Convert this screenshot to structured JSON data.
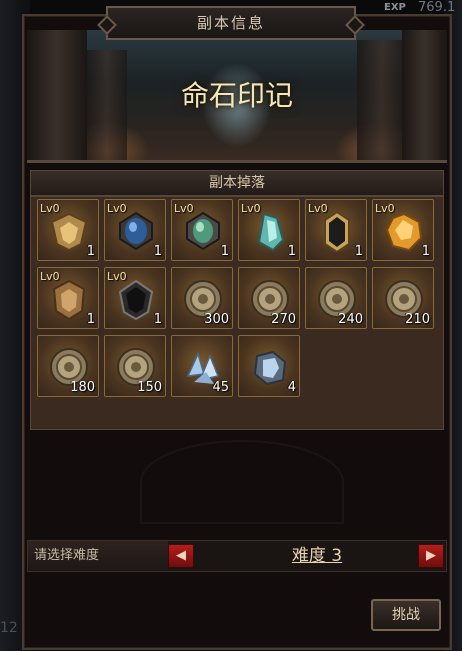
{
  "background": {
    "exp_label": "EXP",
    "exp_value": "769.1",
    "left_number": "12"
  },
  "dialog": {
    "title": "副本信息"
  },
  "banner": {
    "title": "命石印记"
  },
  "drops": {
    "header": "副本掉落",
    "items": [
      {
        "level": "Lv0",
        "count": "1",
        "icon": "amber-crest-gem-icon"
      },
      {
        "level": "Lv0",
        "count": "1",
        "icon": "blue-gem-icon"
      },
      {
        "level": "Lv0",
        "count": "1",
        "icon": "green-gem-icon"
      },
      {
        "level": "Lv0",
        "count": "1",
        "icon": "teal-crystal-icon"
      },
      {
        "level": "Lv0",
        "count": "1",
        "icon": "dark-crystal-icon"
      },
      {
        "level": "Lv0",
        "count": "1",
        "icon": "orange-gem-icon"
      },
      {
        "level": "Lv0",
        "count": "1",
        "icon": "bronze-crest-gem-icon"
      },
      {
        "level": "Lv0",
        "count": "1",
        "icon": "black-gem-icon"
      },
      {
        "level": "",
        "count": "300",
        "icon": "coin-icon"
      },
      {
        "level": "",
        "count": "270",
        "icon": "coin-icon"
      },
      {
        "level": "",
        "count": "240",
        "icon": "coin-icon"
      },
      {
        "level": "",
        "count": "210",
        "icon": "coin-icon"
      },
      {
        "level": "",
        "count": "180",
        "icon": "coin-icon"
      },
      {
        "level": "",
        "count": "150",
        "icon": "coin-icon"
      },
      {
        "level": "",
        "count": "45",
        "icon": "crystal-shards-icon"
      },
      {
        "level": "",
        "count": "4",
        "icon": "puzzle-crystal-icon"
      }
    ]
  },
  "difficulty": {
    "label": "请选择难度",
    "value": "难度 3",
    "prev_symbol": "◀",
    "next_symbol": "▶"
  },
  "challenge_button": "挑战",
  "colors": {
    "slot_border": "#8b6a35",
    "arrow_red": "#b51e1a",
    "gold_text": "#f7e7b4"
  }
}
